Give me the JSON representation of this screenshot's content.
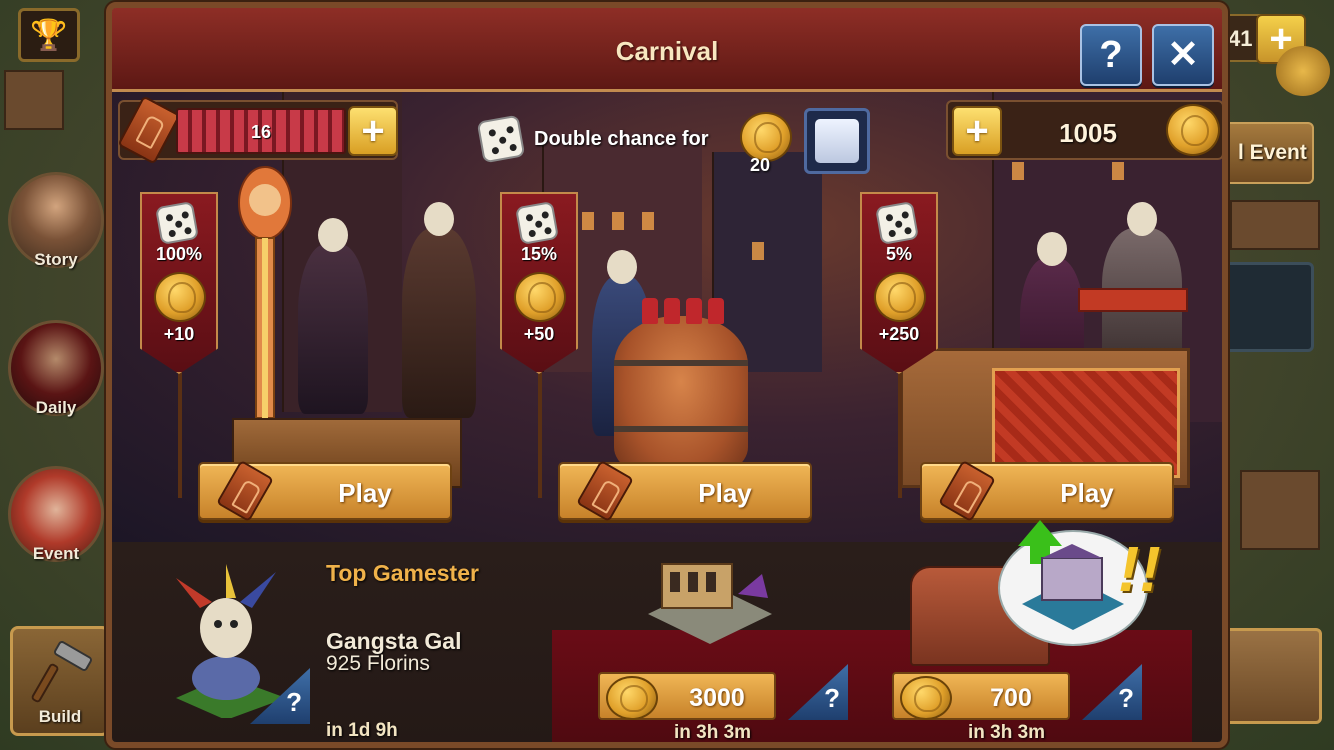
{
  "window": {
    "title": "Carnival",
    "help_label": "?",
    "close_label": "✕"
  },
  "top_bar": {
    "tickets_count": "16",
    "add_label": "+",
    "double_chance_label": "Double chance for",
    "double_chance_cost": "20",
    "florins_amount": "1005"
  },
  "games": [
    {
      "chance": "100%",
      "reward": "+10",
      "play_label": "Play"
    },
    {
      "chance": "15%",
      "reward": "+50",
      "play_label": "Play"
    },
    {
      "chance": "5%",
      "reward": "+250",
      "play_label": "Play"
    }
  ],
  "leaderboard": {
    "heading": "Top Gamester",
    "player_name": "Gangsta Gal",
    "player_score": "925 Florins",
    "time_left": "in 1d 9h"
  },
  "prizes": [
    {
      "cost": "3000",
      "time_left": "in 3h 3m"
    },
    {
      "cost": "700",
      "time_left": "in 3h 3m"
    }
  ],
  "side_menu": {
    "story_label": "Story",
    "daily_label": "Daily",
    "event_label": "Event",
    "build_label": "Build"
  },
  "right_hud": {
    "counter_text": "41",
    "plus_label": "+",
    "event_button_text": "l Event"
  },
  "colors": {
    "title_bar": "#8e2e26",
    "gold_button": "#f0b656",
    "blue_button": "#3e6fa8",
    "banner_red": "#8a1a20",
    "heading_orange": "#f0b24a"
  }
}
